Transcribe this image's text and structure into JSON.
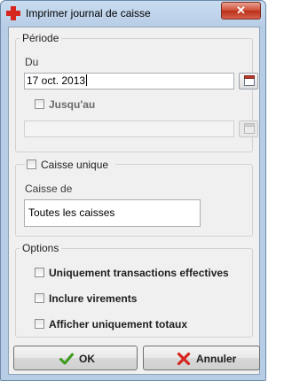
{
  "window": {
    "title": "Imprimer journal de caisse",
    "close_label": "✕"
  },
  "periode": {
    "legend": "Période",
    "du_label": "Du",
    "du_value": "17 oct. 2013",
    "jusquau_label": "Jusqu'au",
    "jusquau_value": ""
  },
  "caisse": {
    "checkbox_label": "Caisse unique",
    "caisse_de_label": "Caisse de",
    "caisse_de_value": "Toutes les caisses"
  },
  "options": {
    "legend": "Options",
    "items": [
      {
        "label": "Uniquement transactions effectives"
      },
      {
        "label": "Inclure virements"
      },
      {
        "label": "Afficher uniquement totaux"
      }
    ]
  },
  "buttons": {
    "ok": "OK",
    "cancel": "Annuler"
  },
  "colors": {
    "accent": "#d7261f",
    "ok_green": "#3c9a1a",
    "cancel_red": "#d7261f"
  }
}
